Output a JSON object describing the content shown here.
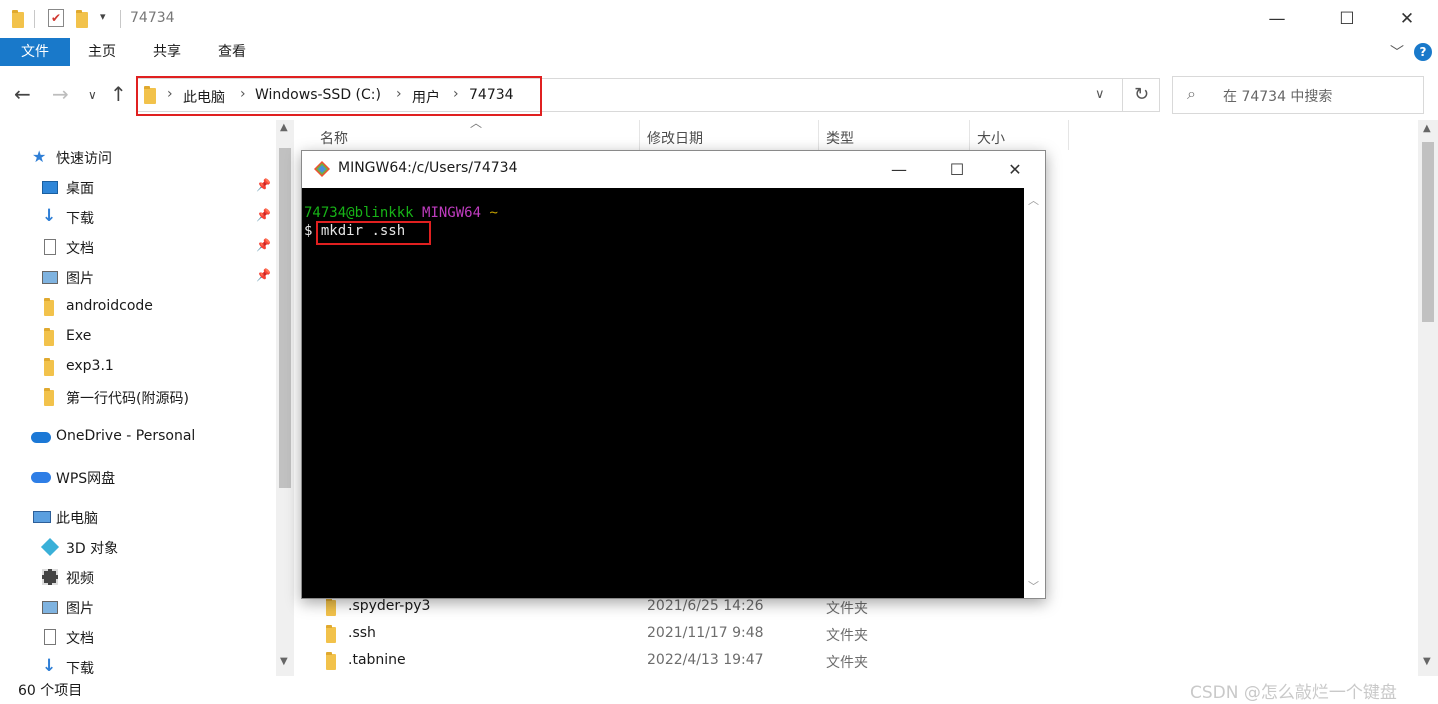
{
  "window": {
    "title": "74734",
    "minimize": "—",
    "maximize": "☐",
    "close": "✕"
  },
  "ribbon": {
    "tabs": [
      "文件",
      "主页",
      "共享",
      "查看"
    ]
  },
  "address": {
    "crumbs": [
      "此电脑",
      "Windows-SSD (C:)",
      "用户",
      "74734"
    ],
    "search_placeholder": "在 74734 中搜索"
  },
  "sidebar": {
    "items": [
      {
        "label": "快速访问",
        "icon": "star-icon"
      },
      {
        "label": "桌面",
        "icon": "desktop-icon",
        "pinned": true
      },
      {
        "label": "下载",
        "icon": "download-icon",
        "pinned": true
      },
      {
        "label": "文档",
        "icon": "document-icon",
        "pinned": true
      },
      {
        "label": "图片",
        "icon": "picture-icon",
        "pinned": true
      },
      {
        "label": "androidcode",
        "icon": "folder-icon"
      },
      {
        "label": "Exe",
        "icon": "folder-icon"
      },
      {
        "label": "exp3.1",
        "icon": "folder-icon"
      },
      {
        "label": "第一行代码(附源码)",
        "icon": "folder-icon"
      },
      {
        "label": "OneDrive - Personal",
        "icon": "cloud-icon"
      },
      {
        "label": "WPS网盘",
        "icon": "cloud-icon"
      },
      {
        "label": "此电脑",
        "icon": "computer-icon"
      },
      {
        "label": "3D 对象",
        "icon": "cube-icon"
      },
      {
        "label": "视频",
        "icon": "video-icon"
      },
      {
        "label": "图片",
        "icon": "picture-icon"
      },
      {
        "label": "文档",
        "icon": "document-icon"
      },
      {
        "label": "下载",
        "icon": "download-icon"
      }
    ]
  },
  "columns": {
    "name": "名称",
    "modified": "修改日期",
    "type": "类型",
    "size": "大小"
  },
  "files": [
    {
      "name": ".spyder-py3",
      "modified": "2021/6/25 14:26",
      "type": "文件夹"
    },
    {
      "name": ".ssh",
      "modified": "2021/11/17 9:48",
      "type": "文件夹"
    },
    {
      "name": ".tabnine",
      "modified": "2022/4/13 19:47",
      "type": "文件夹"
    }
  ],
  "status": {
    "count": "60 个项目",
    "watermark": "CSDN @怎么敲烂一个键盘"
  },
  "terminal": {
    "title": "MINGW64:/c/Users/74734",
    "user_host": "74734@blinkkk",
    "shell": "MINGW64",
    "path": "~",
    "prompt": "$",
    "command": "mkdir .ssh",
    "colors": {
      "user": "#17b317",
      "shell": "#bf3cbf",
      "path": "#c4a000",
      "text": "#e6e6e6"
    }
  },
  "colors": {
    "accent": "#1979ca",
    "highlight": "#e02020",
    "folder": "#f2c24b"
  }
}
